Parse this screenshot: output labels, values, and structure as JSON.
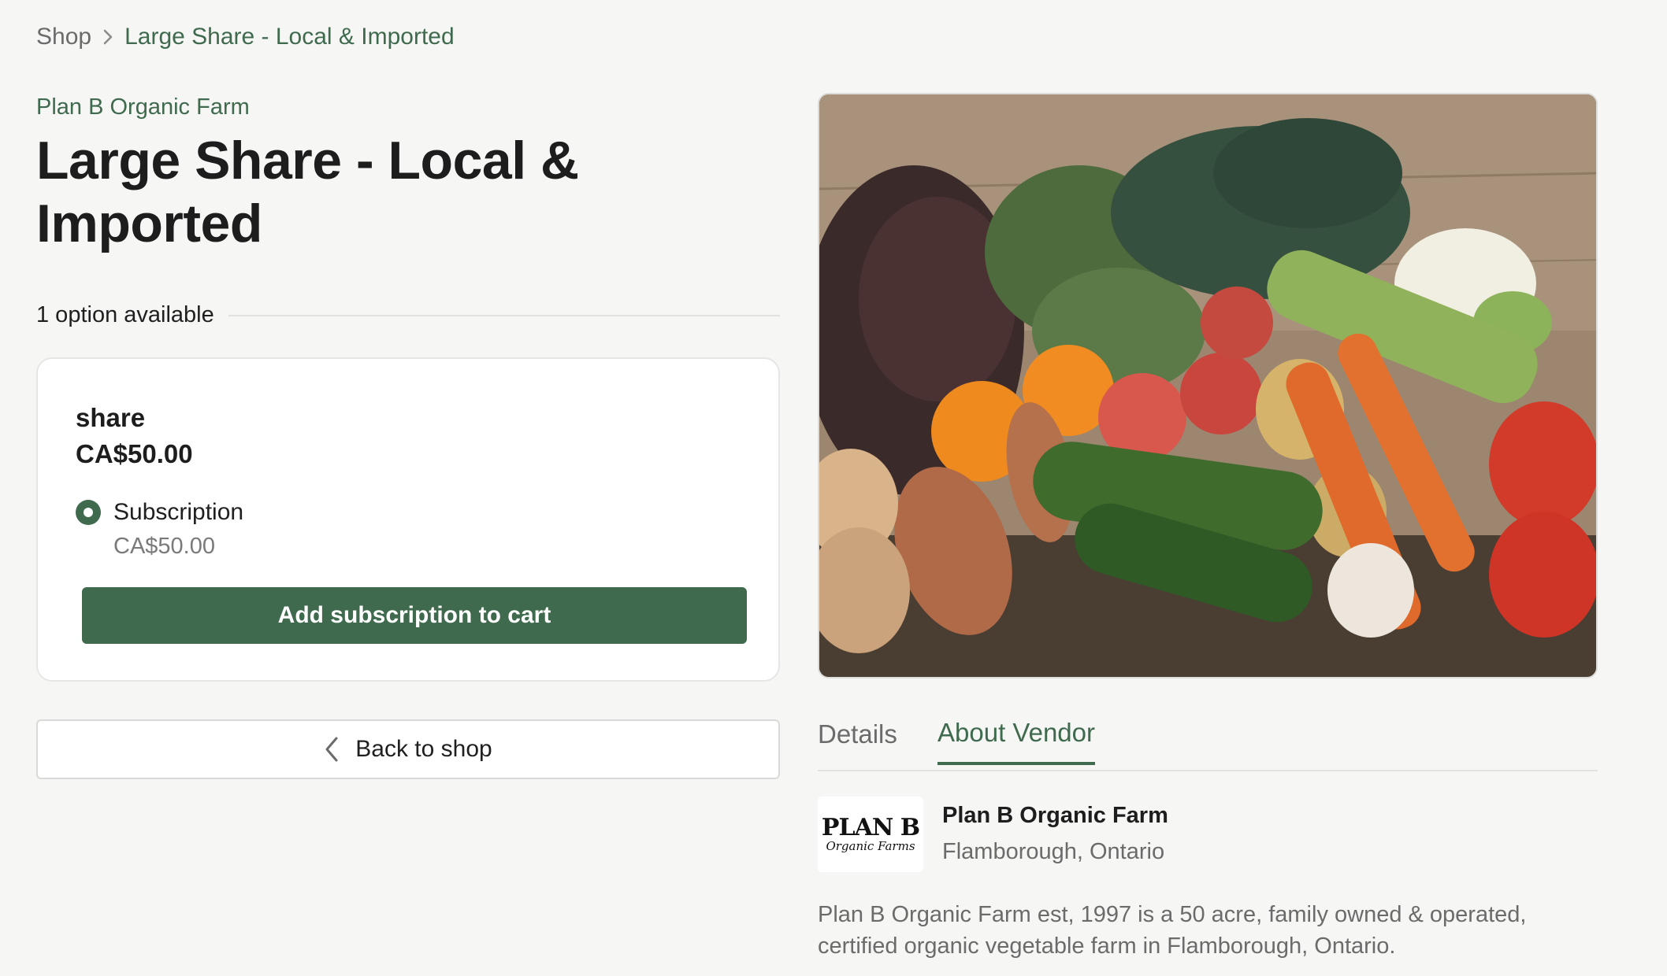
{
  "breadcrumb": {
    "shop": "Shop",
    "current": "Large Share - Local & Imported"
  },
  "product": {
    "vendor": "Plan B Organic Farm",
    "title": "Large Share - Local & Imported",
    "options_available": "1 option available"
  },
  "option_card": {
    "name": "share",
    "price": "CA$50.00",
    "radio_label": "Subscription",
    "radio_price": "CA$50.00",
    "radio_selected": true,
    "add_button": "Add subscription to cart"
  },
  "back_button": "Back to shop",
  "tabs": [
    {
      "label": "Details",
      "active": false
    },
    {
      "label": "About Vendor",
      "active": true
    }
  ],
  "vendor": {
    "logo_main": "PLAN B",
    "logo_sub": "Organic Farms",
    "name": "Plan B Organic Farm",
    "location": "Flamborough, Ontario",
    "description": "Plan B Organic Farm est, 1997 is a 50 acre, family owned & operated, certified organic vegetable farm in Flamborough, Ontario."
  },
  "colors": {
    "accent": "#3f6a4e",
    "background": "#f6f6f5"
  }
}
